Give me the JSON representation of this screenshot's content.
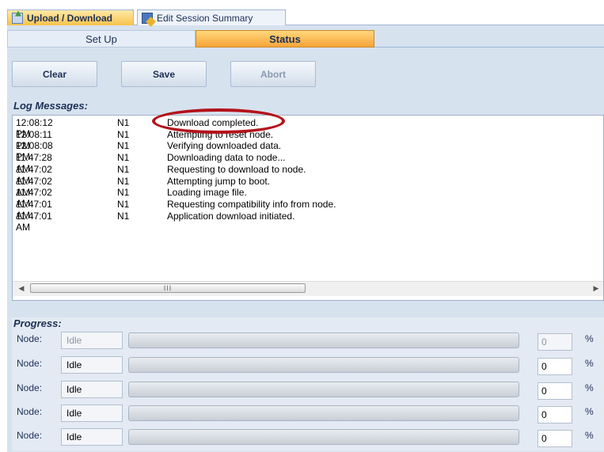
{
  "tabs": {
    "upload_download": "Upload / Download",
    "edit_session_summary": "Edit Session Summary"
  },
  "subtabs": {
    "setup": "Set Up",
    "status": "Status"
  },
  "buttons": {
    "clear": "Clear",
    "save": "Save",
    "abort": "Abort"
  },
  "log": {
    "title": "Log Messages:",
    "rows": [
      {
        "time": "12:08:12 PM",
        "node": "N1",
        "message": "Download completed."
      },
      {
        "time": "12:08:11 PM",
        "node": "N1",
        "message": "Attempting to reset node."
      },
      {
        "time": "12:08:08 PM",
        "node": "N1",
        "message": "Verifying downloaded data."
      },
      {
        "time": "11:47:28 AM",
        "node": "N1",
        "message": "Downloading data to node..."
      },
      {
        "time": "11:47:02 AM",
        "node": "N1",
        "message": "Requesting to download to node."
      },
      {
        "time": "11:47:02 AM",
        "node": "N1",
        "message": "Attempting jump to boot."
      },
      {
        "time": "11:47:02 AM",
        "node": "N1",
        "message": "Loading image file."
      },
      {
        "time": "11:47:01 AM",
        "node": "N1",
        "message": "Requesting compatibility info from node."
      },
      {
        "time": "11:47:01 AM",
        "node": "N1",
        "message": "Application download initiated."
      }
    ],
    "scroll_grip": "III"
  },
  "progress": {
    "title": "Progress:",
    "rows": [
      {
        "label": "Node:",
        "state": "Idle",
        "value": "0",
        "unit": "%",
        "fill": 0
      },
      {
        "label": "Node:",
        "state": "Idle",
        "value": "0",
        "unit": "%",
        "fill": 0
      },
      {
        "label": "Node:",
        "state": "Idle",
        "value": "0",
        "unit": "%",
        "fill": 0
      },
      {
        "label": "Node:",
        "state": "Idle",
        "value": "0",
        "unit": "%",
        "fill": 0
      },
      {
        "label": "Node:",
        "state": "Idle",
        "value": "0",
        "unit": "%",
        "fill": 0
      }
    ]
  },
  "colors": {
    "highlight_ring": "#b4121b",
    "active_tab": "#f7a43a",
    "panel": "#d7e2ef"
  }
}
